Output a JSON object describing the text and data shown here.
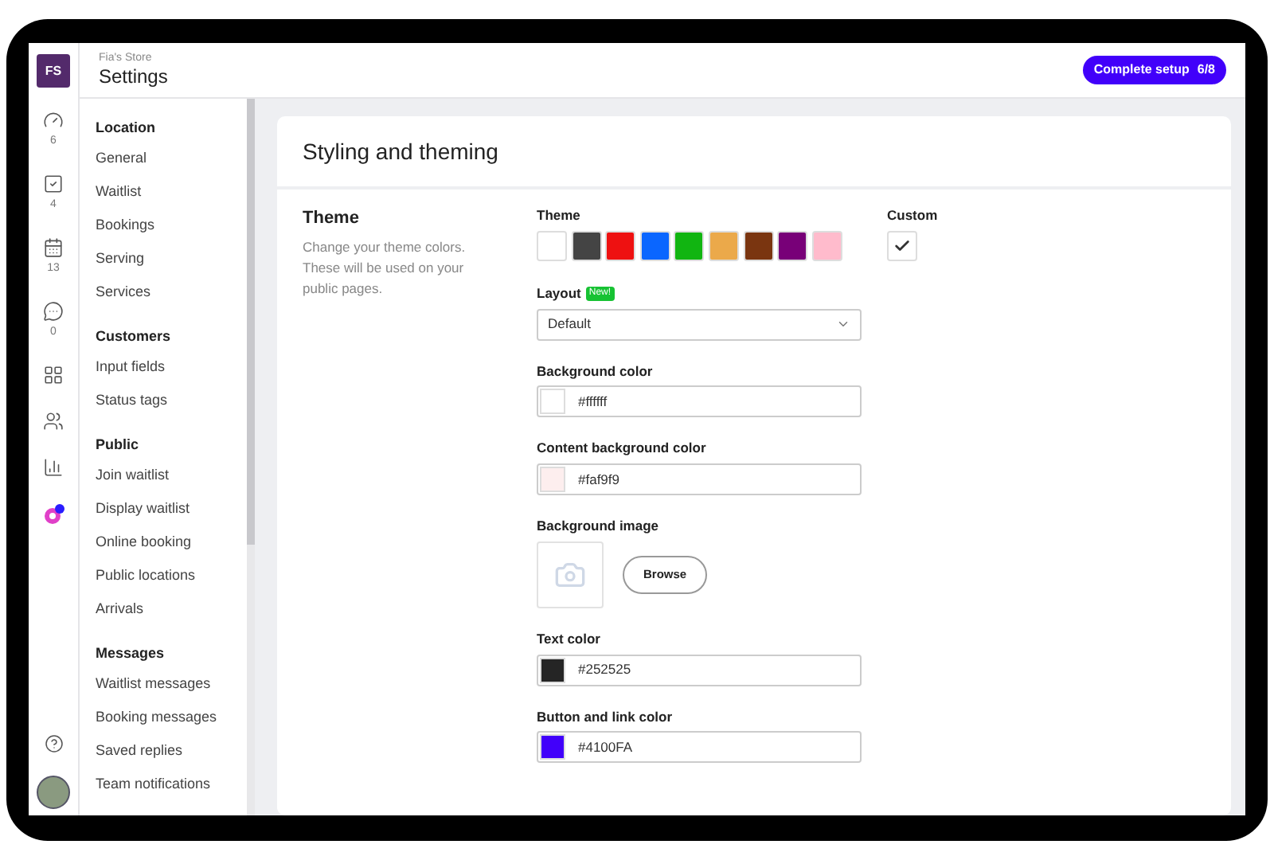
{
  "header": {
    "store": "Fia's Store",
    "title": "Settings",
    "avatar_initials": "FS",
    "setup_button": {
      "label": "Complete setup",
      "progress": "6/8"
    }
  },
  "rail": [
    {
      "kind": "gauge",
      "count": "6"
    },
    {
      "kind": "check",
      "count": "4"
    },
    {
      "kind": "calendar",
      "count": "13"
    },
    {
      "kind": "chat",
      "count": "0"
    },
    {
      "kind": "grid"
    },
    {
      "kind": "users"
    },
    {
      "kind": "chart"
    },
    {
      "kind": "apps"
    }
  ],
  "nav": [
    {
      "heading": "Location",
      "items": [
        "General",
        "Waitlist",
        "Bookings",
        "Serving",
        "Services"
      ]
    },
    {
      "heading": "Customers",
      "items": [
        "Input fields",
        "Status tags"
      ]
    },
    {
      "heading": "Public",
      "items": [
        "Join waitlist",
        "Display waitlist",
        "Online booking",
        "Public locations",
        "Arrivals"
      ]
    },
    {
      "heading": "Messages",
      "items": [
        "Waitlist messages",
        "Booking messages",
        "Saved replies",
        "Team notifications"
      ]
    }
  ],
  "card": {
    "title": "Styling and theming",
    "section": {
      "title": "Theme",
      "description": "Change your theme colors. These will be used on your public pages."
    },
    "theme": {
      "label": "Theme",
      "swatches": [
        {
          "color": "#ffffff"
        },
        {
          "color": "#444444"
        },
        {
          "color": "#ee1111"
        },
        {
          "color": "#0a66ff"
        },
        {
          "color": "#11b511"
        },
        {
          "color": "#eba94a"
        },
        {
          "color": "#7a3510"
        },
        {
          "color": "#780078"
        },
        {
          "color": "#ffbbcc"
        }
      ]
    },
    "custom": {
      "label": "Custom",
      "checked": true
    },
    "layout": {
      "label": "Layout",
      "badge": "New!",
      "value": "Default"
    },
    "fields": [
      {
        "kind": "color",
        "label": "Background color",
        "value": "#ffffff",
        "color": "#ffffff"
      },
      {
        "kind": "color",
        "label": "Content background color",
        "value": "#faf9f9",
        "color": "#fdeeee"
      },
      {
        "kind": "image",
        "label": "Background image",
        "button": "Browse"
      },
      {
        "kind": "color",
        "label": "Text color",
        "value": "#252525",
        "color": "#252525"
      },
      {
        "kind": "color",
        "label": "Button and link color",
        "value": "#4100FA",
        "color": "#4100fa"
      }
    ]
  }
}
